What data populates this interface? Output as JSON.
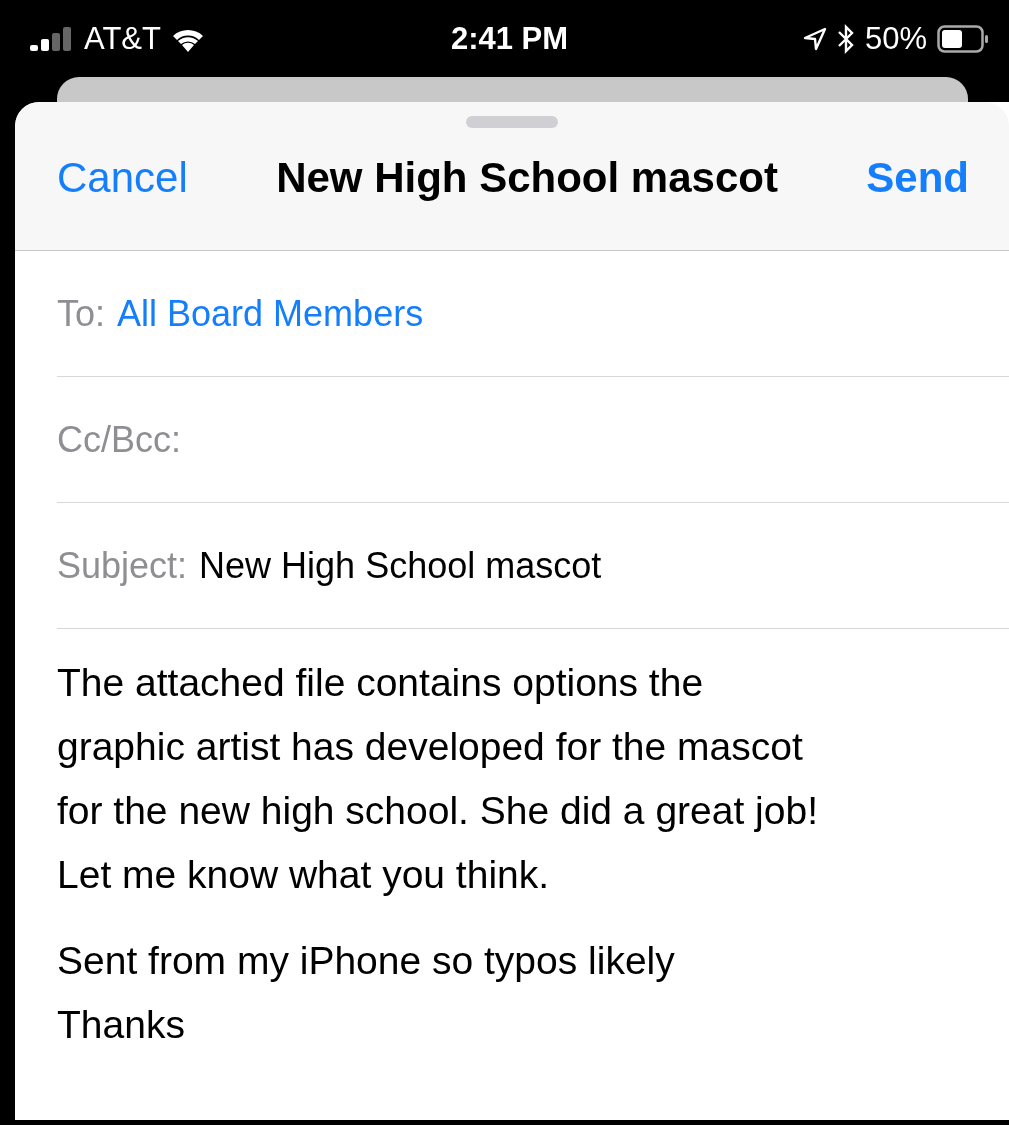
{
  "status_bar": {
    "carrier": "AT&T",
    "time": "2:41 PM",
    "battery": "50%"
  },
  "header": {
    "cancel": "Cancel",
    "title": "New High School mascot",
    "send": "Send"
  },
  "fields": [
    {
      "label": "To:",
      "recipient": "All Board Members"
    },
    {
      "label": "Cc/Bcc:"
    },
    {
      "label": "Subject:",
      "value": "New High School mascot"
    }
  ],
  "body": [
    "The attached file contains options the\ngraphic artist has developed for the mascot\nfor the new high school. She did a great job!\nLet me know what you think.",
    "Sent from my iPhone so typos likely\nThanks"
  ]
}
